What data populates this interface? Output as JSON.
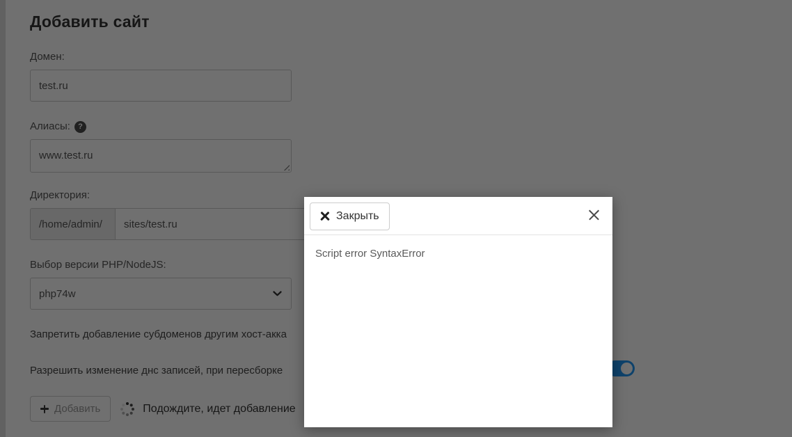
{
  "page": {
    "title": "Добавить сайт",
    "form": {
      "domain": {
        "label": "Домен:",
        "value": "test.ru"
      },
      "aliases": {
        "label": "Алиасы:",
        "value": "www.test.ru"
      },
      "directory": {
        "label": "Директория:",
        "prefix": "/home/admin/",
        "value": "sites/test.ru"
      },
      "php": {
        "label": "Выбор версии PHP/NodeJS:",
        "selected": "php74w"
      },
      "options": [
        {
          "label": "Запретить добавление субдоменов другим хост-акка"
        },
        {
          "label": "Разрешить изменение днс записей, при пересборке",
          "toggle_on": true
        }
      ],
      "submit": {
        "label": "Добавить",
        "busy_text": "Подождите, идет добавление"
      }
    },
    "icons": {
      "help": "question-circle-icon",
      "select": "chevron-down-icon",
      "submit": "plus-icon",
      "busy": "spinner-icon",
      "modal_button": "times-heavy-icon",
      "modal_corner": "close-x-icon"
    },
    "colors": {
      "toggle_on_accent": "#2196f3",
      "backdrop": "rgba(0,0,0,0.56)"
    }
  },
  "modal": {
    "close_button_label": "Закрыть",
    "help_text": "?",
    "message": "Script error SyntaxError"
  }
}
